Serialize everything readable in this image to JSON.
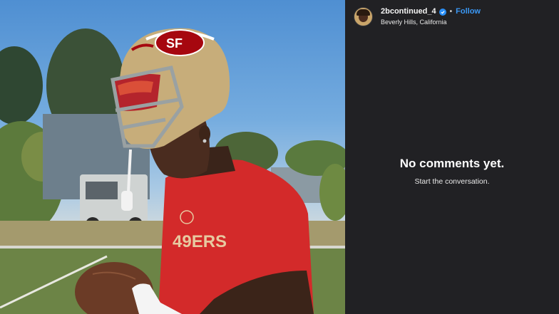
{
  "post": {
    "username": "2bcontinued_4",
    "location": "Beverly Hills, California",
    "follow_label": "Follow",
    "separator": "•"
  },
  "comments": {
    "empty_title": "No comments yet.",
    "empty_subtitle": "Start the conversation."
  },
  "photo": {
    "helmet_logo": "SF",
    "shirt_text": "49ERS"
  },
  "colors": {
    "panel_bg": "#212124",
    "follow_blue": "#3b98f5",
    "verified_blue": "#2a8ff7",
    "shirt_red": "#d32a2a",
    "helmet_gold": "#c7ad7a"
  },
  "icons": {
    "verified": "verified-badge-icon"
  }
}
